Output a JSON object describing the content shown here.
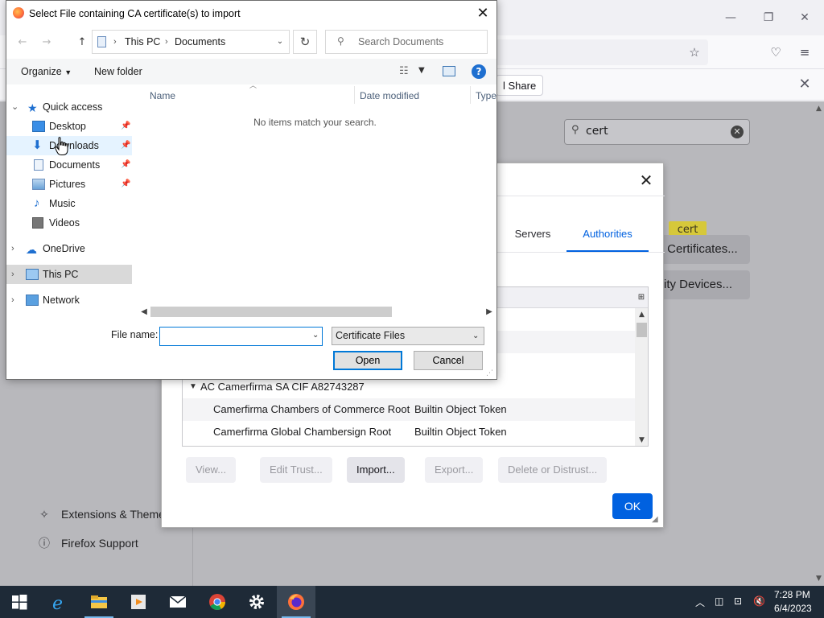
{
  "file_dialog": {
    "title": "Select File containing CA certificate(s) to import",
    "address": {
      "crumbs": [
        "This PC",
        "Documents"
      ]
    },
    "search_placeholder": "Search Documents",
    "toolbar": {
      "organize": "Organize",
      "new_folder": "New folder"
    },
    "nav": {
      "quick_access": "Quick access",
      "desktop": "Desktop",
      "downloads": "Downloads",
      "documents": "Documents",
      "pictures": "Pictures",
      "music": "Music",
      "videos": "Videos",
      "onedrive": "OneDrive",
      "this_pc": "This PC",
      "network": "Network"
    },
    "columns": {
      "name": "Name",
      "date_modified": "Date modified",
      "type": "Type"
    },
    "empty_message": "No items match your search.",
    "file_name_label": "File name:",
    "file_name_value": "",
    "filter_selected": "Certificate Files",
    "open_label": "Open",
    "cancel_label": "Cancel"
  },
  "cert_manager": {
    "tabs": {
      "servers": "Servers",
      "authorities": "Authorities"
    },
    "rows": [
      {
        "text": "",
        "token": "",
        "partial": ""
      },
      {
        "text": "",
        "token": "",
        "partial": "en"
      },
      {
        "text": "",
        "token": "",
        "partial": "en"
      },
      {
        "group": "AC Camerfirma SA CIF A82743287"
      },
      {
        "text": "Camerfirma Chambers of Commerce Root",
        "token": "Builtin Object Token"
      },
      {
        "text": "Camerfirma Global Chambersign Root",
        "token": "Builtin Object Token"
      }
    ],
    "buttons": {
      "view": "View...",
      "edit_trust": "Edit Trust...",
      "import": "Import...",
      "export": "Export...",
      "delete": "Delete or Distrust..."
    },
    "ok": "OK"
  },
  "firefox": {
    "notification_share": "l Share",
    "search_value": "cert",
    "search_highlight": "cert",
    "pref_btn_certs": "Certificates...",
    "pref_btn_certs_prefix": "r ",
    "pref_btn_devices": "rity Devices...",
    "sidebar": {
      "extensions": "Extensions & Themes",
      "support": "Firefox Support"
    }
  },
  "taskbar": {
    "apps": [
      "Start",
      "Internet Explorer",
      "File Explorer",
      "Media Player",
      "Mail",
      "Chrome",
      "Settings",
      "Firefox"
    ],
    "time": "7:28 PM",
    "date": "6/4/2023"
  },
  "colors": {
    "accent": "#0061e0",
    "win_accent": "#0078d7",
    "taskbar": "#1e2a37"
  }
}
